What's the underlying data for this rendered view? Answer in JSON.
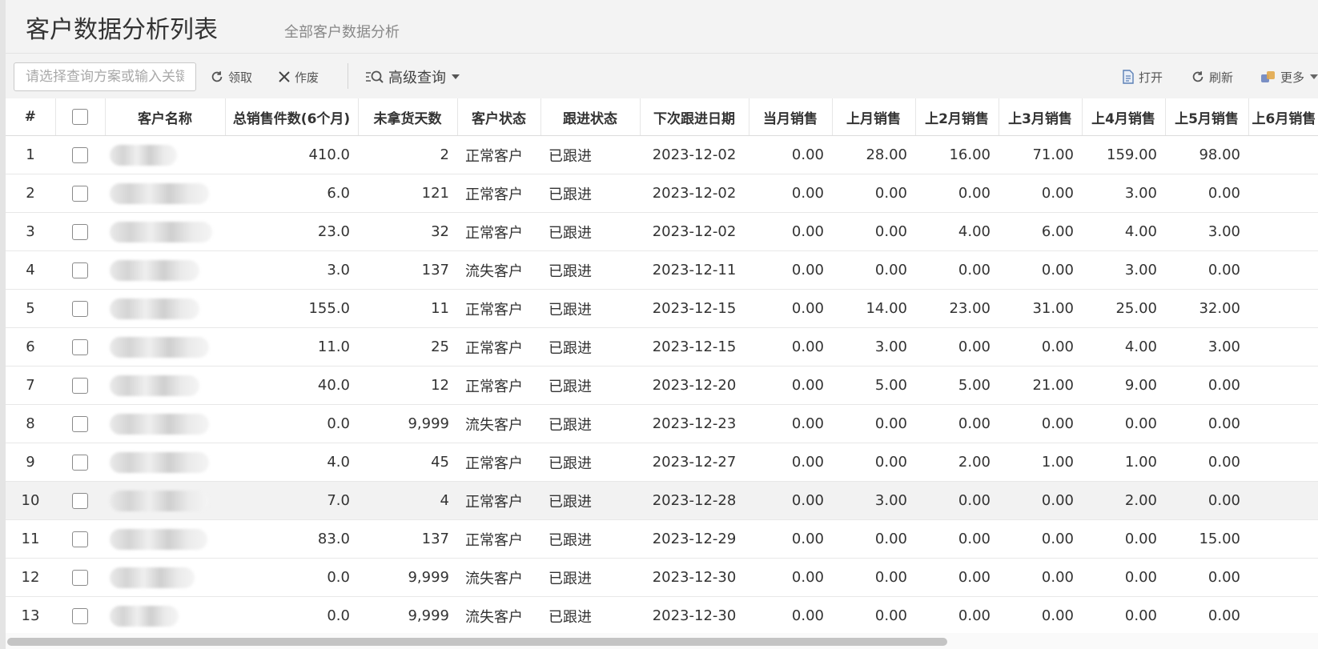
{
  "header": {
    "title": "客户数据分析列表",
    "subtitle": "全部客户数据分析"
  },
  "toolbar": {
    "search_placeholder": "请选择查询方案或输入关键",
    "claim_label": "领取",
    "void_label": "作废",
    "advanced_label": "高级查询",
    "open_label": "打开",
    "refresh_label": "刷新",
    "more_label": "更多"
  },
  "table": {
    "columns": [
      "#",
      "",
      "客户名称",
      "总销售件数(6个月)",
      "未拿货天数",
      "客户状态",
      "跟进状态",
      "下次跟进日期",
      "当月销售",
      "上月销售",
      "上2月销售",
      "上3月销售",
      "上4月销售",
      "上5月销售",
      "上6月销售"
    ],
    "rows": [
      {
        "idx": "1",
        "total": "410.0",
        "days": "2",
        "status": "正常客户",
        "follow": "已跟进",
        "date": "2023-12-02",
        "m0": "0.00",
        "m1": "28.00",
        "m2": "16.00",
        "m3": "71.00",
        "m4": "159.00",
        "m5": "98.00"
      },
      {
        "idx": "2",
        "total": "6.0",
        "days": "121",
        "status": "正常客户",
        "follow": "已跟进",
        "date": "2023-12-02",
        "m0": "0.00",
        "m1": "0.00",
        "m2": "0.00",
        "m3": "0.00",
        "m4": "3.00",
        "m5": "0.00"
      },
      {
        "idx": "3",
        "total": "23.0",
        "days": "32",
        "status": "正常客户",
        "follow": "已跟进",
        "date": "2023-12-02",
        "m0": "0.00",
        "m1": "0.00",
        "m2": "4.00",
        "m3": "6.00",
        "m4": "4.00",
        "m5": "3.00"
      },
      {
        "idx": "4",
        "total": "3.0",
        "days": "137",
        "status": "流失客户",
        "follow": "已跟进",
        "date": "2023-12-11",
        "m0": "0.00",
        "m1": "0.00",
        "m2": "0.00",
        "m3": "0.00",
        "m4": "3.00",
        "m5": "0.00"
      },
      {
        "idx": "5",
        "total": "155.0",
        "days": "11",
        "status": "正常客户",
        "follow": "已跟进",
        "date": "2023-12-15",
        "m0": "0.00",
        "m1": "14.00",
        "m2": "23.00",
        "m3": "31.00",
        "m4": "25.00",
        "m5": "32.00"
      },
      {
        "idx": "6",
        "total": "11.0",
        "days": "25",
        "status": "正常客户",
        "follow": "已跟进",
        "date": "2023-12-15",
        "m0": "0.00",
        "m1": "3.00",
        "m2": "0.00",
        "m3": "0.00",
        "m4": "4.00",
        "m5": "3.00"
      },
      {
        "idx": "7",
        "total": "40.0",
        "days": "12",
        "status": "正常客户",
        "follow": "已跟进",
        "date": "2023-12-20",
        "m0": "0.00",
        "m1": "5.00",
        "m2": "5.00",
        "m3": "21.00",
        "m4": "9.00",
        "m5": "0.00"
      },
      {
        "idx": "8",
        "total": "0.0",
        "days": "9,999",
        "status": "流失客户",
        "follow": "已跟进",
        "date": "2023-12-23",
        "m0": "0.00",
        "m1": "0.00",
        "m2": "0.00",
        "m3": "0.00",
        "m4": "0.00",
        "m5": "0.00"
      },
      {
        "idx": "9",
        "total": "4.0",
        "days": "45",
        "status": "正常客户",
        "follow": "已跟进",
        "date": "2023-12-27",
        "m0": "0.00",
        "m1": "0.00",
        "m2": "2.00",
        "m3": "1.00",
        "m4": "1.00",
        "m5": "0.00"
      },
      {
        "idx": "10",
        "total": "7.0",
        "days": "4",
        "status": "正常客户",
        "follow": "已跟进",
        "date": "2023-12-28",
        "m0": "0.00",
        "m1": "3.00",
        "m2": "0.00",
        "m3": "0.00",
        "m4": "2.00",
        "m5": "0.00"
      },
      {
        "idx": "11",
        "total": "83.0",
        "days": "137",
        "status": "正常客户",
        "follow": "已跟进",
        "date": "2023-12-29",
        "m0": "0.00",
        "m1": "0.00",
        "m2": "0.00",
        "m3": "0.00",
        "m4": "0.00",
        "m5": "15.00"
      },
      {
        "idx": "12",
        "total": "0.0",
        "days": "9,999",
        "status": "流失客户",
        "follow": "已跟进",
        "date": "2023-12-30",
        "m0": "0.00",
        "m1": "0.00",
        "m2": "0.00",
        "m3": "0.00",
        "m4": "0.00",
        "m5": "0.00"
      },
      {
        "idx": "13",
        "total": "0.0",
        "days": "9,999",
        "status": "流失客户",
        "follow": "已跟进",
        "date": "2023-12-30",
        "m0": "0.00",
        "m1": "0.00",
        "m2": "0.00",
        "m3": "0.00",
        "m4": "0.00",
        "m5": "0.00"
      }
    ]
  }
}
